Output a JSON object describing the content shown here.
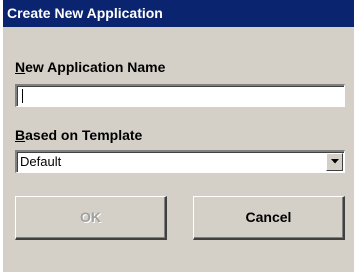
{
  "window": {
    "title": "Create New Application"
  },
  "name_field": {
    "label_mnemonic": "N",
    "label_rest": "ew Application Name",
    "value": ""
  },
  "template_field": {
    "label_mnemonic": "B",
    "label_rest": "ased on Template",
    "selected": "Default",
    "arrow_icon": "dropdown-arrow-icon"
  },
  "buttons": {
    "ok_label": "OK",
    "ok_enabled": false,
    "cancel_label": "Cancel"
  },
  "colors": {
    "titlebar": "#0a2470",
    "dialog_face": "#d4d0c8",
    "disabled_text": "#a0a0a0"
  }
}
